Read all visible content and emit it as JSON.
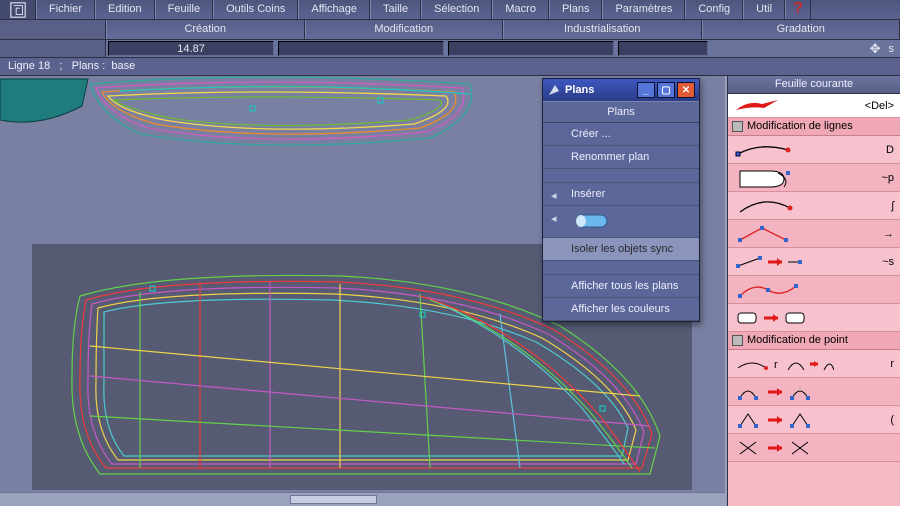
{
  "menu": {
    "items": [
      "Fichier",
      "Edition",
      "Feuille",
      "Outils Coins",
      "Affichage",
      "Taille",
      "Sélection",
      "Macro",
      "Plans",
      "Paramètres",
      "Config",
      "Util"
    ],
    "help_glyph": "?"
  },
  "modes": [
    "Création",
    "Modification",
    "Industrialisation",
    "Gradation"
  ],
  "values": {
    "v0": "14.87",
    "v1": "",
    "v2": "",
    "v3": ""
  },
  "valbar_right": {
    "glyph": "✥",
    "suffix": "s"
  },
  "status": {
    "line_label": "Ligne 18",
    "sep": ";",
    "plans_label": "Plans :",
    "plans_value": "base"
  },
  "dialog": {
    "title": "Plans",
    "header": "Plans",
    "items": [
      {
        "label": "Créer ...",
        "arrow": false
      },
      {
        "label": "Renommer plan",
        "arrow": false
      }
    ],
    "insert_label": "Insérer",
    "selected_label": "Isoler les objets sync",
    "footer": [
      "Afficher tous les plans",
      "Afficher les couleurs"
    ]
  },
  "right_panel": {
    "header": "Feuille courante",
    "first_row_key": "<Del>",
    "section1": "Modification de lignes",
    "rows1": [
      {
        "key": "D"
      },
      {
        "key": "~p"
      },
      {
        "key": "ʃ"
      },
      {
        "key": "→"
      },
      {
        "key": "~s"
      },
      {
        "key": ""
      }
    ],
    "section2": "Modification de point",
    "rows2": [
      {
        "key": "r"
      },
      {
        "key": ""
      },
      {
        "key": "("
      },
      {
        "key": ""
      }
    ]
  }
}
